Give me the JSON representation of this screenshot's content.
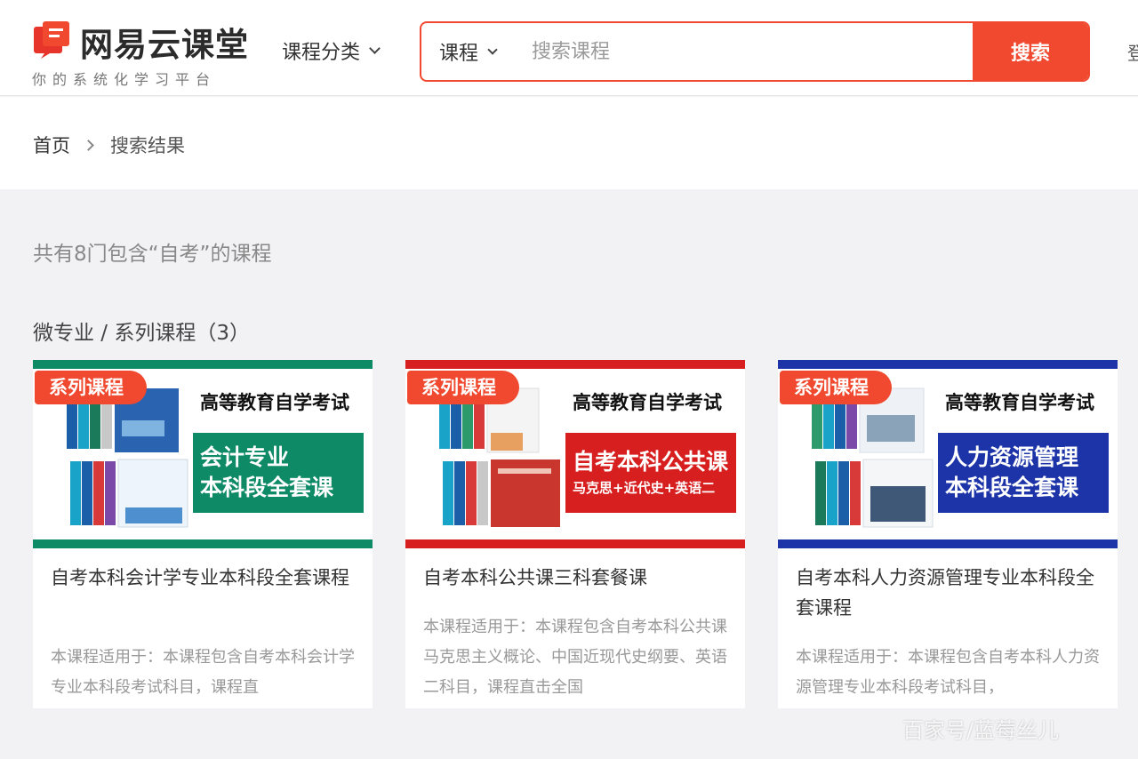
{
  "header": {
    "logo_name": "网易云课堂",
    "logo_slogan": "你的系统化学习平台",
    "category_menu": "课程分类",
    "search_type": "课程",
    "search_placeholder": "搜索课程",
    "search_button": "搜索",
    "edge_text": "登"
  },
  "breadcrumb": {
    "home": "首页",
    "current": "搜索结果"
  },
  "results": {
    "count_text": "共有8门包含“自考”的课程",
    "section_title": "微专业 / 系列课程（3）"
  },
  "cards": [
    {
      "badge": "系列课程",
      "exam_title": "高等教育自学考试",
      "promo_line1": "会计专业",
      "promo_line2": "本科段全套课",
      "accent": "#0e8a66",
      "title": "自考本科会计学专业本科段全套课程",
      "desc": "本课程适用于：本课程包含自考本科会计学专业本科段考试科目，课程直"
    },
    {
      "badge": "系列课程",
      "exam_title": "高等教育自学考试",
      "promo_line1": "自考本科公共课",
      "promo_line2": "马克思+近代史+英语二",
      "accent": "#d71f1f",
      "title": "自考本科公共课三科套餐课",
      "desc": "本课程适用于：本课程包含自考本科公共课马克思主义概论、中国近现代史纲要、英语二科目，课程直击全国"
    },
    {
      "badge": "系列课程",
      "exam_title": "高等教育自学考试",
      "promo_line1": "人力资源管理",
      "promo_line2": "本科段全套课",
      "accent": "#1d33a8",
      "title": "自考本科人力资源管理专业本科段全套课程",
      "desc": "本课程适用于：本课程包含自考本科人力资源管理专业本科段考试科目，"
    }
  ],
  "colors": {
    "brand": "#f0492f",
    "badge": "#f0492f"
  },
  "watermark": "百家号/蓝莓丝儿"
}
